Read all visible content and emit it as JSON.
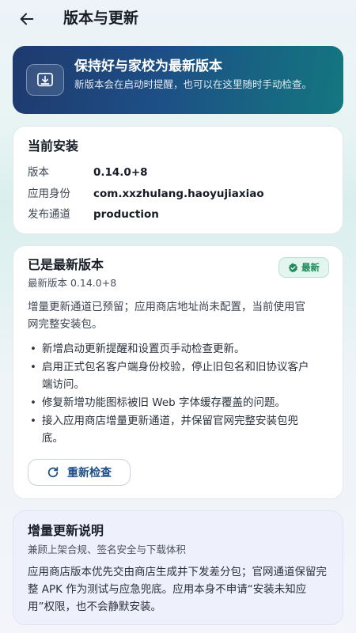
{
  "appbar": {
    "title": "版本与更新"
  },
  "hero": {
    "title": "保持好与家校为最新版本",
    "description": "新版本会在启动时提醒，也可以在这里随时手动检查。"
  },
  "install": {
    "title": "当前安装",
    "rows": [
      {
        "label": "版本",
        "value": "0.14.0+8"
      },
      {
        "label": "应用身份",
        "value": "com.xxzhulang.haoyujiaxiao"
      },
      {
        "label": "发布通道",
        "value": "production"
      }
    ]
  },
  "latest": {
    "title": "已是最新版本",
    "badge": "最新",
    "subtitle": "最新版本 0.14.0+8",
    "notice": "增量更新通道已预留；应用商店地址尚未配置，当前使用官网完整安装包。",
    "changes": [
      "新增启动更新提醒和设置页手动检查更新。",
      "启用正式包名客户端身份校验，停止旧包名和旧协议客户端访问。",
      "修复新增功能图标被旧 Web 字体缓存覆盖的问题。",
      "接入应用商店增量更新通道，并保留官网完整安装包兜底。"
    ],
    "recheck_label": "重新检查"
  },
  "explain": {
    "title": "增量更新说明",
    "subtitle": "兼顾上架合规、签名安全与下载体积",
    "body": "应用商店版本优先交由商店生成并下发差分包；官网通道保留完整 APK 作为测试与应急兜底。应用本身不申请“安装未知应用”权限，也不会静默安装。"
  },
  "colors": {
    "hero_start": "#1e3a6e",
    "hero_end": "#13777f",
    "badge_green": "#1f8a5b",
    "accent_blue": "#1d4f86"
  },
  "icons": {
    "back": "arrow-left-icon",
    "hero": "download-box-icon",
    "badge": "check-circle-icon",
    "recheck": "refresh-icon"
  }
}
